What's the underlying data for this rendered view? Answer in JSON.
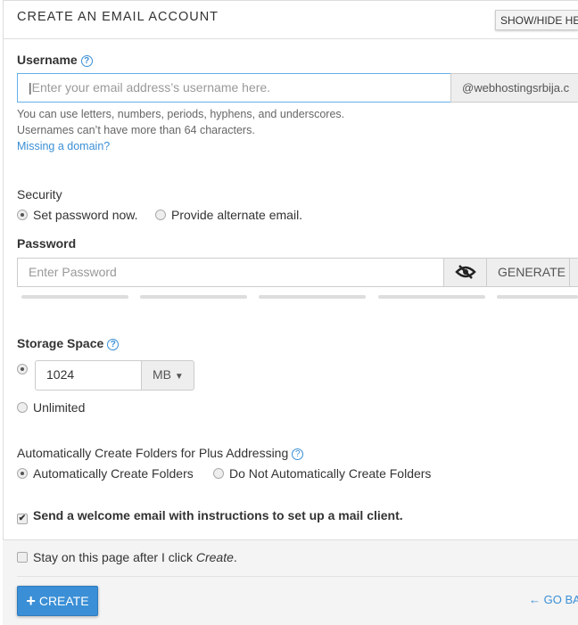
{
  "header": {
    "title": "CREATE AN EMAIL ACCOUNT",
    "show_hide": "SHOW/HIDE HE"
  },
  "username": {
    "label": "Username",
    "placeholder": "Enter your email address’s username here.",
    "domain": "@webhostingsrbija.c",
    "help1": "You can use letters, numbers, periods, hyphens, and underscores.",
    "help2": "Usernames can’t have more than 64 characters.",
    "missing_domain": "Missing a domain?"
  },
  "security": {
    "label": "Security",
    "opt_set": "Set password now.",
    "opt_alt": "Provide alternate email.",
    "selected": "Set password now."
  },
  "password": {
    "label": "Password",
    "placeholder": "Enter Password",
    "generate": "GENERATE",
    "strength_bars_filled": 0
  },
  "storage": {
    "label": "Storage Space",
    "value": "1024",
    "unit": "MB",
    "unlimited": "Unlimited",
    "selected": "quota"
  },
  "plus": {
    "label": "Automatically Create Folders for Plus Addressing",
    "opt_auto": "Automatically Create Folders",
    "opt_no": "Do Not Automatically Create Folders",
    "selected": "Automatically Create Folders"
  },
  "welcome": {
    "label": "Send a welcome email with instructions to set up a mail client.",
    "checked": true
  },
  "footer": {
    "stay_prefix": "Stay on this page after I click ",
    "stay_em": "Create",
    "stay_suffix": ".",
    "create": "CREATE",
    "go_back": "GO BA"
  }
}
